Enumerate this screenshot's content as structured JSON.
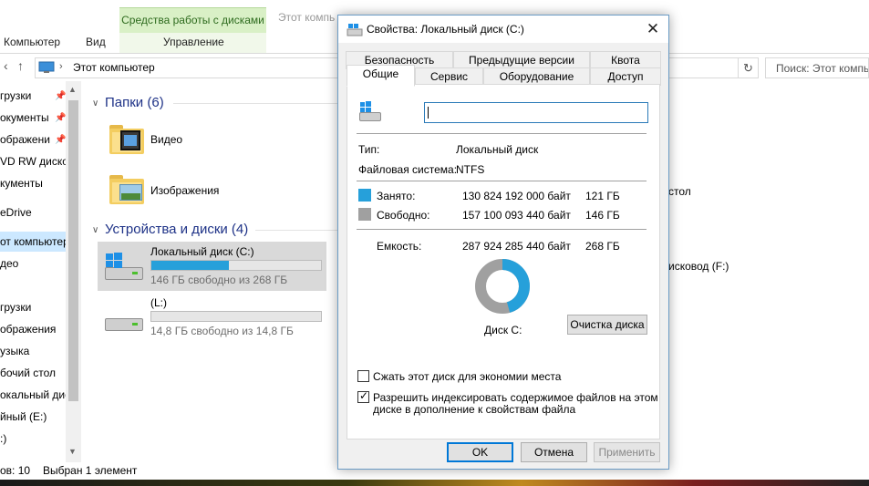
{
  "explorer": {
    "ribbon": {
      "context_header": "Средства работы с дисками",
      "tabs": [
        "Компьютер",
        "Вид",
        "Управление"
      ],
      "faded_tabs": [
        "Этот компь"
      ]
    },
    "address": {
      "path": "Этот компьютер",
      "search_placeholder": "Поиск: Этот компь"
    },
    "nav": [
      {
        "label": "грузки",
        "pinned": true
      },
      {
        "label": "окументы",
        "pinned": true
      },
      {
        "label": "ображени",
        "pinned": true
      },
      {
        "label": "VD RW дисков",
        "pinned": false
      },
      {
        "label": "кументы",
        "pinned": false
      },
      {
        "label": "eDrive",
        "pinned": false
      },
      {
        "label": "от компьютер",
        "pinned": false,
        "selected": true
      },
      {
        "label": "део",
        "pinned": false
      },
      {
        "label": "грузки",
        "pinned": false
      },
      {
        "label": "ображения",
        "pinned": false
      },
      {
        "label": "узыка",
        "pinned": false
      },
      {
        "label": "бочий стол",
        "pinned": false
      },
      {
        "label": "окальный дис",
        "pinned": false
      },
      {
        "label": "йный (E:)",
        "pinned": false
      },
      {
        "label": ":)",
        "pinned": false
      }
    ],
    "folders_header": "Папки (6)",
    "folders": [
      "Видео",
      "Изображения"
    ],
    "devices_header": "Устройства и диски (4)",
    "drives": [
      {
        "name": "Локальный диск (C:)",
        "free_text": "146 ГБ свободно из 268 ГБ",
        "used_fraction": 0.455
      },
      {
        "name": "(L:)",
        "free_text": "14,8 ГБ свободно из 14,8 ГБ",
        "used_fraction": 0.0
      }
    ],
    "right_partial": [
      "стол",
      "исковод (F:)"
    ],
    "status": {
      "items": "ов: 10",
      "selected": "Выбран 1 элемент"
    }
  },
  "dialog": {
    "title": "Свойства: Локальный диск (C:)",
    "tabs_row1": [
      "Безопасность",
      "Предыдущие версии",
      "Квота"
    ],
    "tabs_row2": [
      "Общие",
      "Сервис",
      "Оборудование",
      "Доступ"
    ],
    "active_tab": "Общие",
    "name_value": "",
    "type_label": "Тип:",
    "type_value": "Локальный диск",
    "fs_label": "Файловая система:",
    "fs_value": "NTFS",
    "used": {
      "label": "Занято:",
      "bytes": "130 824 192 000 байт",
      "size": "121 ГБ",
      "color": "#26a0da"
    },
    "free": {
      "label": "Свободно:",
      "bytes": "157 100 093 440 байт",
      "size": "146 ГБ",
      "color": "#a0a0a0"
    },
    "capacity": {
      "label": "Емкость:",
      "bytes": "287 924 285 440 байт",
      "size": "268 ГБ"
    },
    "disk_label": "Диск C:",
    "cleanup_button": "Очистка диска",
    "compress_label": "Сжать этот диск для экономии места",
    "compress_checked": false,
    "index_label_1": "Разрешить индексировать содержимое файлов на этом",
    "index_label_2": "диске в дополнение к свойствам файла",
    "index_checked": true,
    "ok": "OK",
    "cancel": "Отмена",
    "apply": "Применить"
  }
}
